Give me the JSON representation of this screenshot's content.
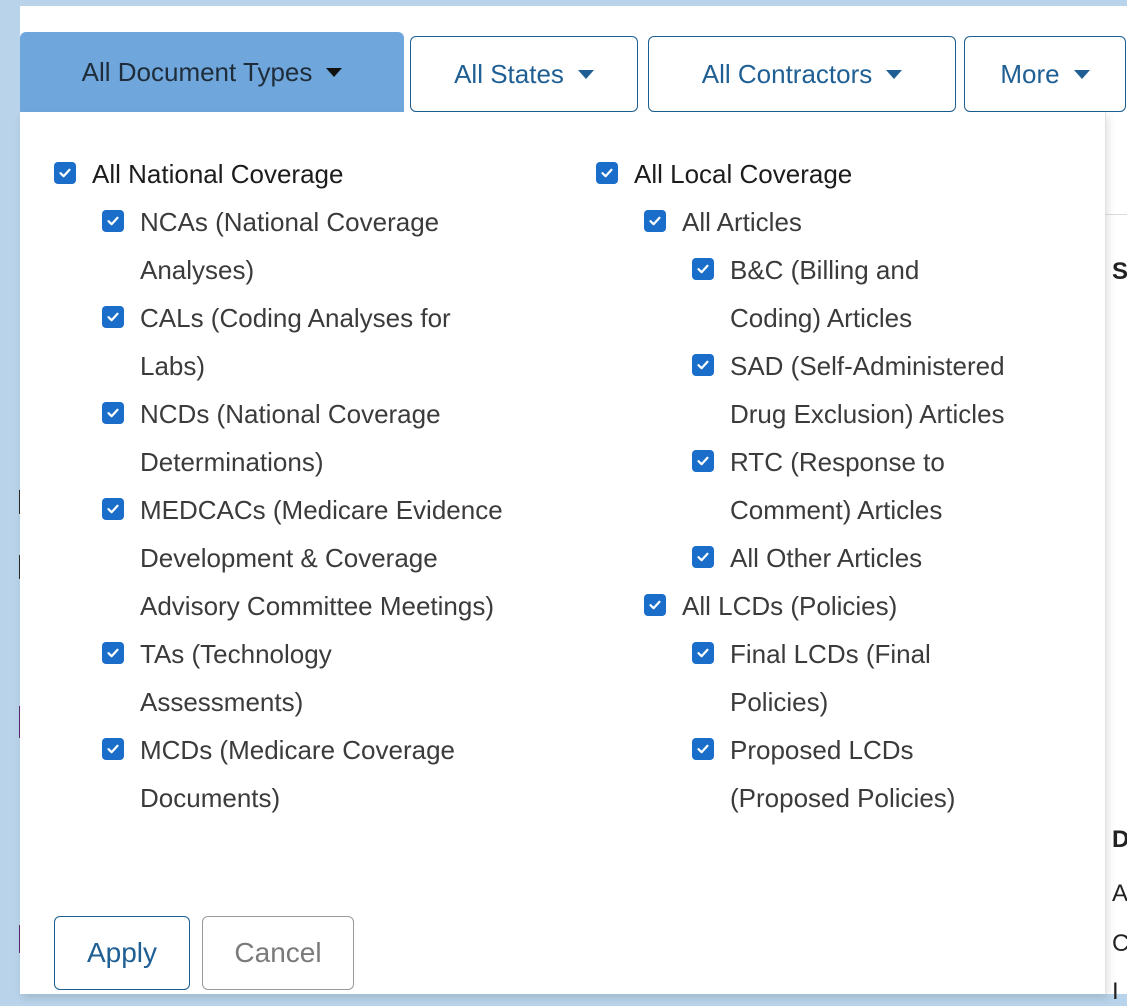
{
  "filters": {
    "document_types": "All Document Types",
    "states": "All States",
    "contractors": "All Contractors",
    "more": "More"
  },
  "national": {
    "header": "All National Coverage",
    "items": [
      "NCAs (National Coverage Analyses)",
      "CALs (Coding Analyses for Labs)",
      "NCDs (National Coverage Determinations)",
      "MEDCACs (Medicare Evidence Development & Coverage Advisory Committee Meetings)",
      "TAs (Technology Assessments)",
      "MCDs (Medicare Coverage Documents)"
    ]
  },
  "local": {
    "header": "All Local Coverage",
    "articles_header": "All Articles",
    "articles": [
      "B&C (Billing and Coding) Articles",
      "SAD (Self-Administered Drug Exclusion) Articles",
      "RTC (Response to Comment) Articles"
    ],
    "other_articles": "All Other Articles",
    "lcds_header": "All LCDs (Policies)",
    "lcds": [
      "Final LCDs (Final Policies)",
      "Proposed LCDs (Proposed Policies)"
    ]
  },
  "actions": {
    "apply": "Apply",
    "cancel": "Cancel"
  },
  "background_peek": {
    "s": "S",
    "d": "D",
    "a": "A",
    "c": "C",
    "l": "I"
  },
  "colors": {
    "checkbox": "#1a6dc9",
    "active_filter_bg": "#6fa6dc",
    "border_blue": "#1c5e8f",
    "page_bg": "#b9d3ea"
  }
}
